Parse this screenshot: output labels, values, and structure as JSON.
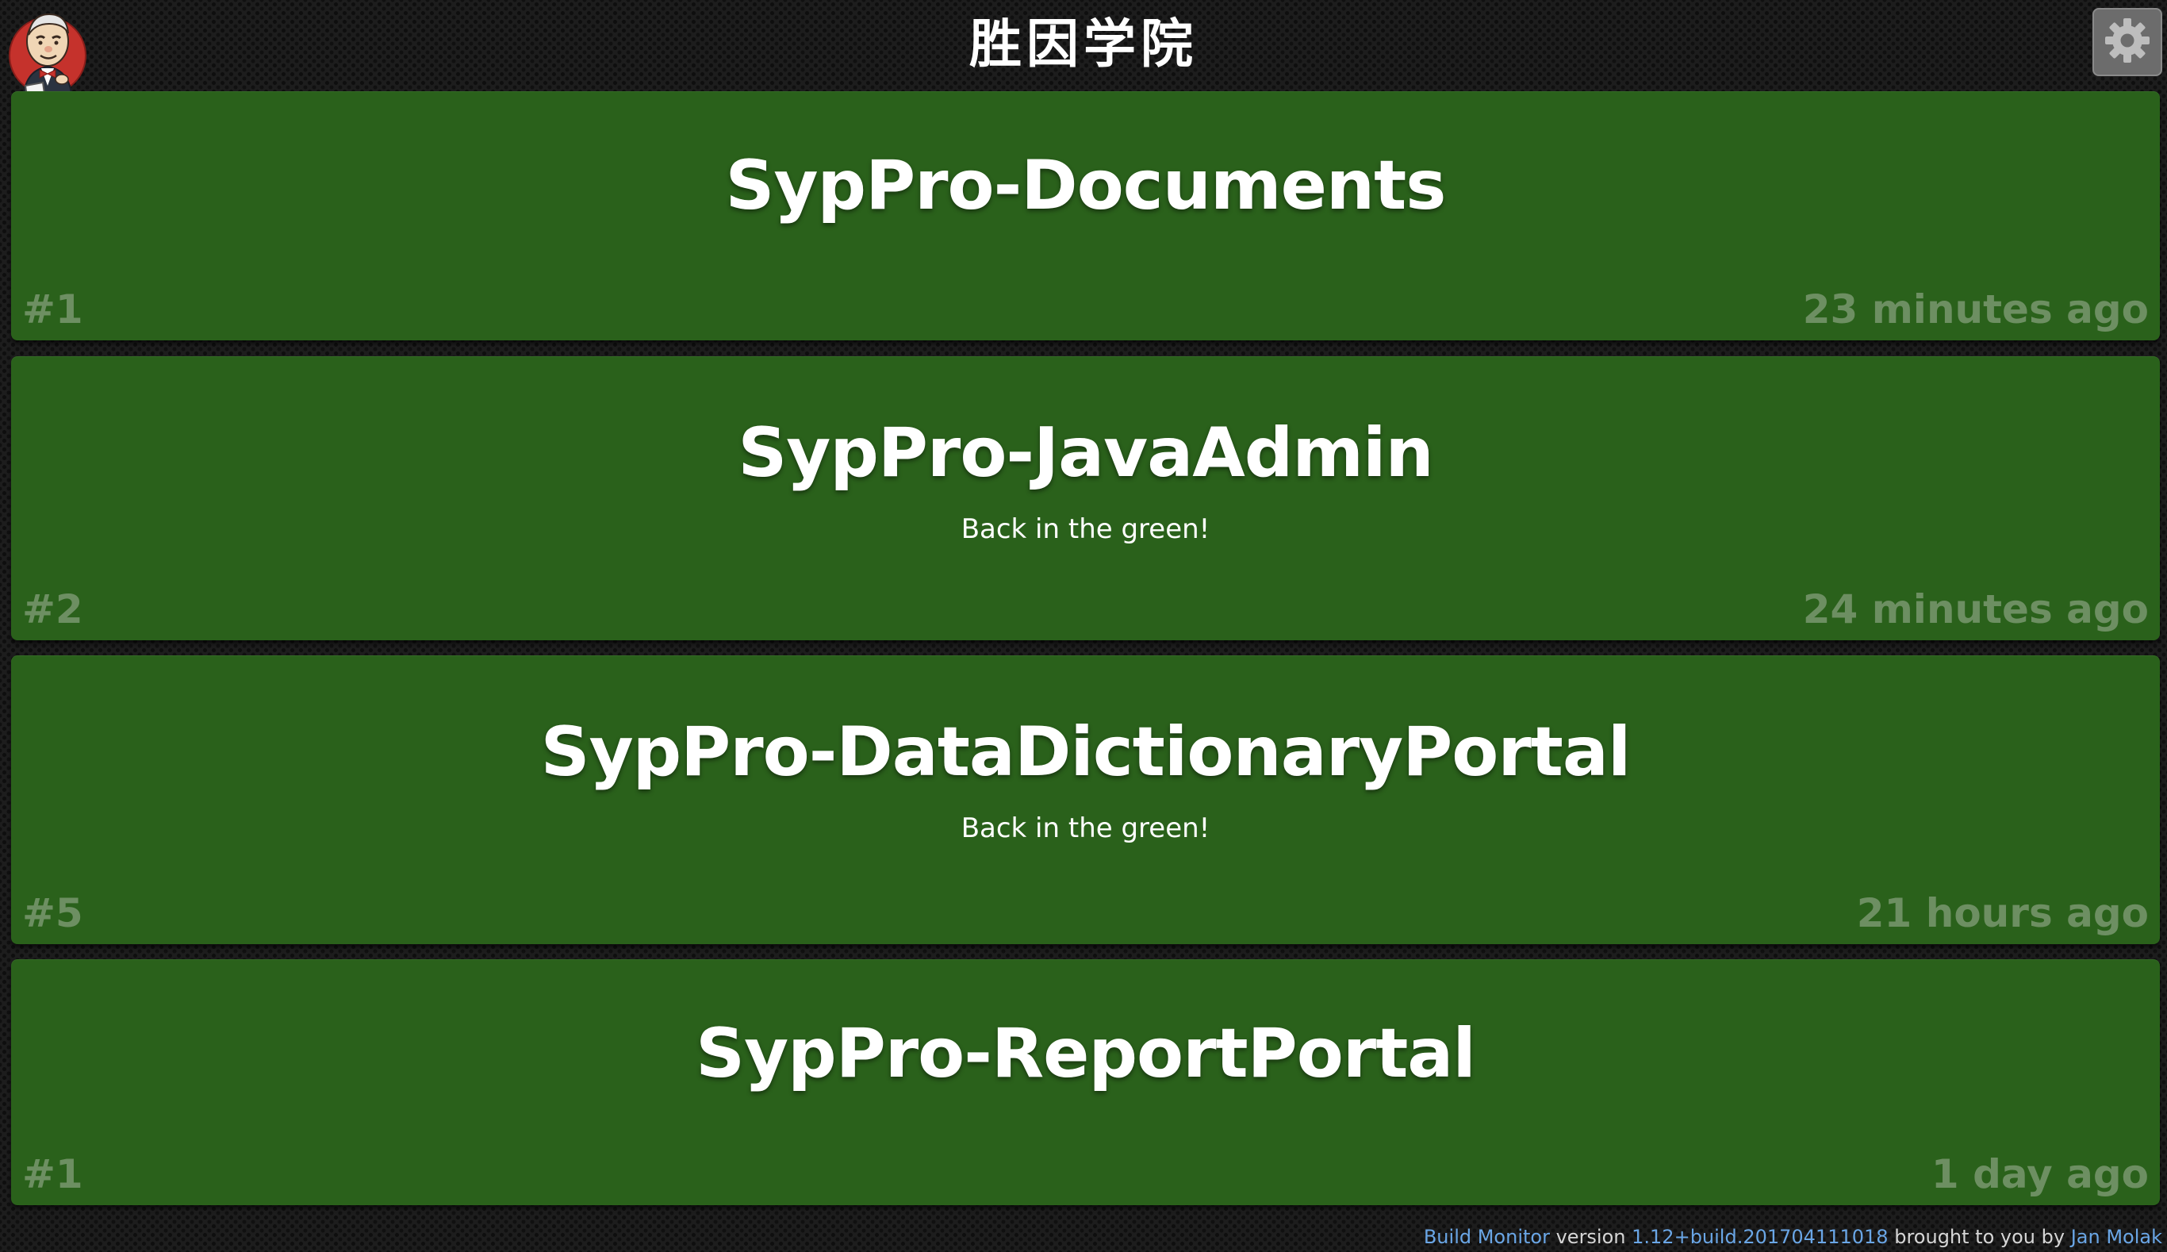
{
  "header": {
    "title": "胜因学院",
    "logo_icon": "jenkins-butler-icon",
    "settings_icon": "gear-icon"
  },
  "colors": {
    "success_tile": "#2a611b",
    "meta_text": "#6d8f62",
    "link": "#6aa6e6"
  },
  "jobs": [
    {
      "name": "SypPro-Documents",
      "status": "",
      "build": "#1",
      "time": "23 minutes ago"
    },
    {
      "name": "SypPro-JavaAdmin",
      "status": "Back in the green!",
      "build": "#2",
      "time": "24 minutes ago"
    },
    {
      "name": "SypPro-DataDictionaryPortal",
      "status": "Back in the green!",
      "build": "#5",
      "time": "21 hours ago"
    },
    {
      "name": "SypPro-ReportPortal",
      "status": "",
      "build": "#1",
      "time": "1 day ago"
    }
  ],
  "footer": {
    "product_link": "Build Monitor",
    "version_label": "version",
    "version_link": "1.12+build.201704111018",
    "brought_by": "brought to you by",
    "author_link": "Jan Molak"
  }
}
